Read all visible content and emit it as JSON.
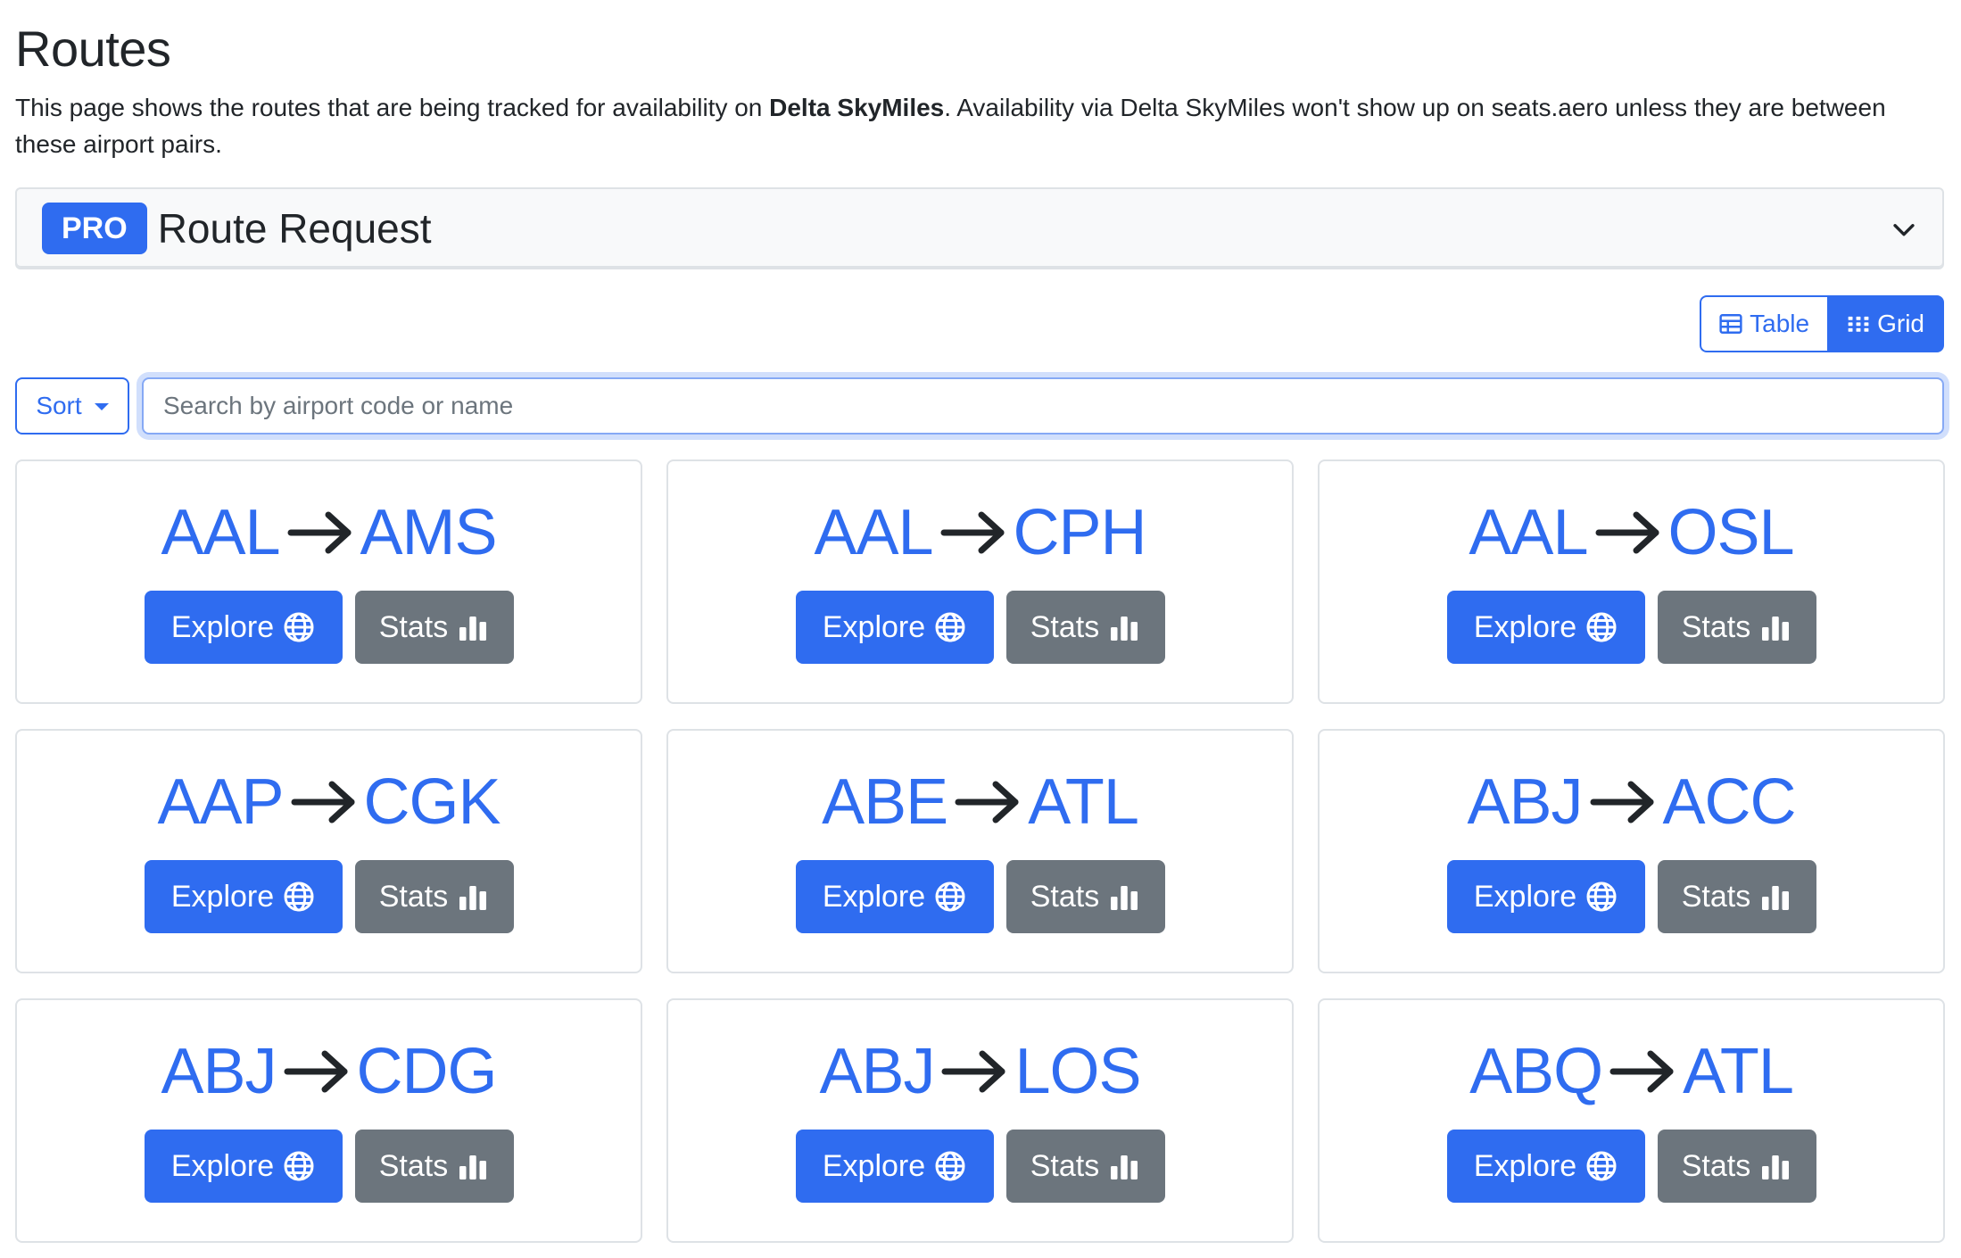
{
  "page": {
    "title": "Routes",
    "intro_before": "This page shows the routes that are being tracked for availability on ",
    "intro_program": "Delta SkyMiles",
    "intro_after": ". Availability via Delta SkyMiles won't show up on seats.aero unless they are between these airport pairs."
  },
  "route_request": {
    "badge": "PRO",
    "title": "Route Request",
    "icon": "chevron-down-icon"
  },
  "view_toggle": {
    "table_label": "Table",
    "grid_label": "Grid",
    "active": "Grid"
  },
  "sort": {
    "label": "Sort"
  },
  "search": {
    "placeholder": "Search by airport code or name",
    "value": ""
  },
  "actions": {
    "explore_label": "Explore",
    "stats_label": "Stats"
  },
  "colors": {
    "primary": "#2f6cf0",
    "secondary": "#6c757d"
  },
  "routes": [
    {
      "origin": "AAL",
      "destination": "AMS"
    },
    {
      "origin": "AAL",
      "destination": "CPH"
    },
    {
      "origin": "AAL",
      "destination": "OSL"
    },
    {
      "origin": "AAP",
      "destination": "CGK"
    },
    {
      "origin": "ABE",
      "destination": "ATL"
    },
    {
      "origin": "ABJ",
      "destination": "ACC"
    },
    {
      "origin": "ABJ",
      "destination": "CDG"
    },
    {
      "origin": "ABJ",
      "destination": "LOS"
    },
    {
      "origin": "ABQ",
      "destination": "ATL"
    }
  ]
}
